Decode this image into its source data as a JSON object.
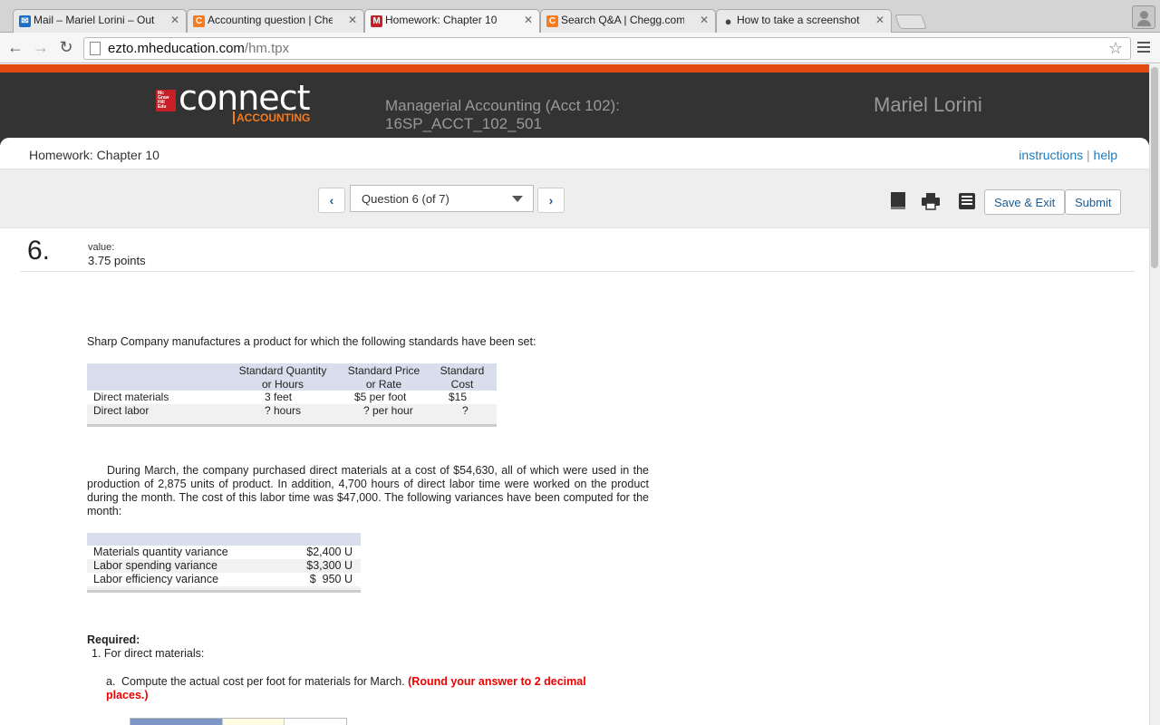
{
  "browser": {
    "tabs": [
      {
        "icon": "mail-icon",
        "title": "Mail – Mariel Lorini – Outlo",
        "color": "#1a6fc6",
        "glyph": "✉"
      },
      {
        "icon": "chegg-icon",
        "title": "Accounting question | Che",
        "color": "#f47b20",
        "glyph": "C"
      },
      {
        "icon": "mcgraw-icon",
        "title": "Homework: Chapter 10",
        "color": "#c62026",
        "glyph": "M"
      },
      {
        "icon": "chegg-icon",
        "title": "Search Q&A | Chegg.com",
        "color": "#f47b20",
        "glyph": "C"
      },
      {
        "icon": "apple-icon",
        "title": "How to take a screenshot c",
        "color": "#555555",
        "glyph": ""
      }
    ],
    "url_host": "ezto.mheducation.com",
    "url_path": "/hm.tpx"
  },
  "header": {
    "brand": "connect",
    "brand_sub": "ACCOUNTING",
    "brand_logo": "Mc Graw Hill Education",
    "course_line1": "Managerial Accounting (Acct 102):",
    "course_line2": "16SP_ACCT_102_501",
    "user_name": "Mariel Lorini"
  },
  "page": {
    "title": "Homework: Chapter 10",
    "instructions": "instructions",
    "separator": "|",
    "help": "help"
  },
  "question_bar": {
    "selected": "Question 6 (of 7)",
    "prev_arrow": "‹",
    "next_arrow": "›",
    "save_exit": "Save & Exit",
    "submit": "Submit"
  },
  "question": {
    "number": "6.",
    "value_label": "value:",
    "points": "3.75 points",
    "intro": "Sharp Company manufactures a product for which the following standards have been set:",
    "standards_headers": [
      {
        "line1": "Standard Quantity",
        "line2": "or Hours"
      },
      {
        "line1": "Standard Price",
        "line2": "or Rate"
      },
      {
        "line1": "Standard",
        "line2": "Cost"
      }
    ],
    "standards_rows": [
      {
        "label": "Direct materials",
        "qty": "3 feet",
        "price": "$5 per foot",
        "cost": "$15"
      },
      {
        "label": "Direct labor",
        "qty": "? hours",
        "price": "? per hour",
        "cost": "?"
      }
    ],
    "paragraph": "During March, the company purchased direct materials at a cost of $54,630, all of which were used in the production of 2,875 units of product. In addition, 4,700 hours of direct labor time were worked on the product during the month. The cost of this labor time was $47,000. The following variances have been computed for the month:",
    "variances": [
      {
        "label": "Materials quantity variance",
        "amount": "$2,400 U"
      },
      {
        "label": "Labor spending variance",
        "amount": "$3,300 U"
      },
      {
        "label": "Labor efficiency variance",
        "amount": "$  950 U"
      }
    ],
    "required_label": "Required:",
    "required_1": "1. For direct materials:",
    "part_a_letter": "a.",
    "part_a_text": "Compute the actual cost per foot for materials for March.",
    "part_a_note": "(Round your answer to 2 decimal places.)"
  }
}
